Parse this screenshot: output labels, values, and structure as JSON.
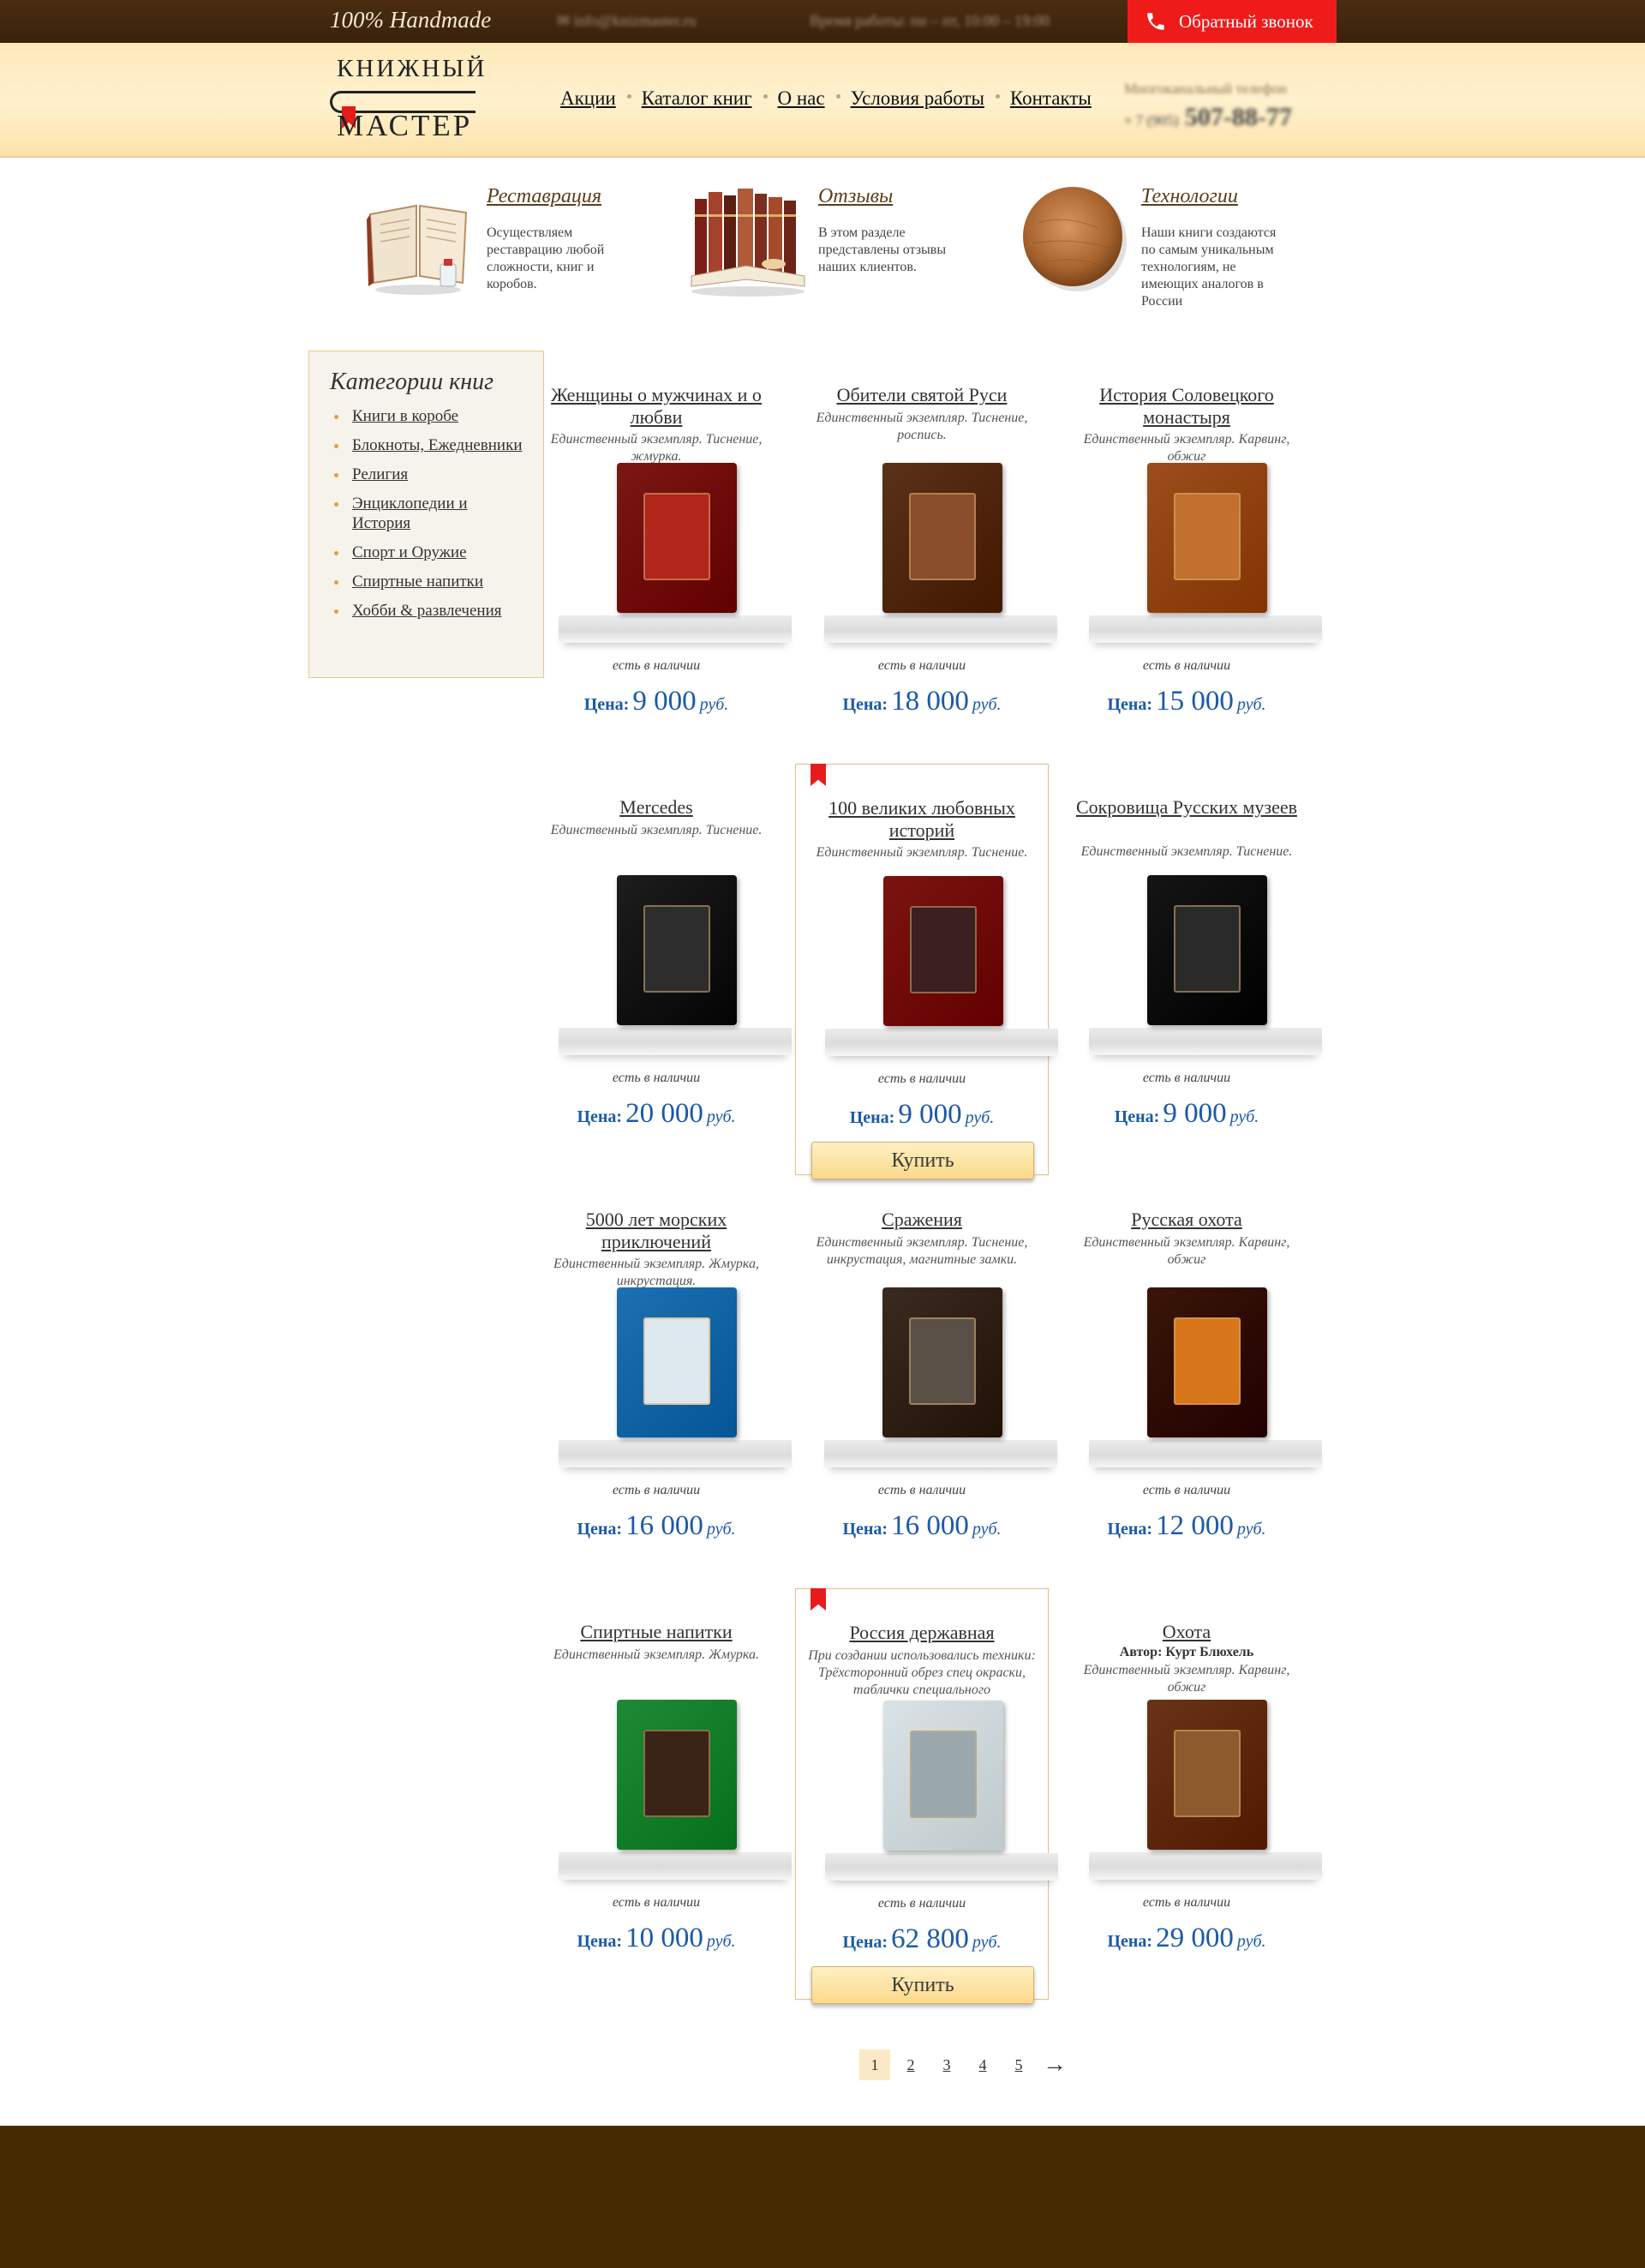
{
  "topbar": {
    "tagline": "100% Handmade",
    "email": "✉ info@knizmaster.ru",
    "hours": "Время работы: пн – пт, 10:00 – 19:00",
    "callback_label": "Обратный звонок"
  },
  "header": {
    "logo_line1": "КНИЖНЫЙ",
    "logo_line2": "МАСТЕР",
    "nav": [
      "Акции",
      "Каталог книг",
      "О нас",
      "Условия работы",
      "Контакты"
    ],
    "phone_label": "Многоканальный телефон",
    "phone_prefix": "+ 7 (905)",
    "phone_number": "507-88-77"
  },
  "features": [
    {
      "title": "Реставрация",
      "text": "Осуществляем реставрацию любой сложности, книг и коробов.",
      "icon": "open-book-icon"
    },
    {
      "title": "Отзывы",
      "text": "В этом разделе представлены отзывы наших клиентов.",
      "icon": "book-stack-icon"
    },
    {
      "title": "Технологии",
      "text": "Наши книги создаются по самым уникальным технологиям, не имеющих аналогов в России",
      "icon": "leather-icon"
    }
  ],
  "sidebar": {
    "title": "Категории книг",
    "items": [
      "Книги в коробе",
      "Блокноты, Ежедневники",
      "Религия",
      "Энциклопедии и История",
      "Спорт и Оружие",
      "Спиртные напитки",
      "Хобби & развлечения"
    ]
  },
  "catalog": {
    "price_label": "Цена:",
    "currency": "руб.",
    "stock_label": "есть в наличии",
    "buy_label": "Купить"
  },
  "products": [
    {
      "title": "Женщины о мужчинах и о любви",
      "desc": "Единственный экземпляр. Тиснение, жмурка.",
      "price": "9 000",
      "cover": "#7a1814",
      "inset": "#b2251d"
    },
    {
      "title": "Обители святой Руси",
      "desc": "Единственный экземпляр. Тиснение, роспись.",
      "price": "18 000",
      "cover": "#5a3119",
      "inset": "#8a4e2c"
    },
    {
      "title": "История Соловецкого монастыря",
      "desc": "Единственный экземпляр. Карвинг, обжиг",
      "price": "15 000",
      "cover": "#9b4e1b",
      "inset": "#c2702d"
    },
    {
      "title": "Mercedes",
      "desc": "Единственный экземпляр. Тиснение.",
      "price": "20 000",
      "cover": "#1d1d1d",
      "inset": "#2d2d2d"
    },
    {
      "title": "100 великих любовных историй",
      "desc": "Единственный экземпляр. Тиснение.",
      "price": "9 000",
      "cover": "#7b1410",
      "inset": "#3a2020"
    },
    {
      "title": "Сокровища Русских музеев",
      "desc": "Единственный экземпляр. Тиснение.",
      "price": "9 000",
      "cover": "#151515",
      "inset": "#2a2a2a"
    },
    {
      "title": "5000 лет морских приключений",
      "desc": "Единственный экземпляр. Жмурка, инкрустация.",
      "price": "16 000",
      "cover": "#1d6fb0",
      "inset": "#dde8ef"
    },
    {
      "title": "Сражения",
      "desc": "Единственный экземпляр. Тиснение, инкрустация, магнитные замки.",
      "price": "16 000",
      "cover": "#3b2a1f",
      "inset": "#5b5048"
    },
    {
      "title": "Русская охота",
      "desc": "Единственный экземпляр. Карвинг, обжиг",
      "price": "12 000",
      "cover": "#3a1608",
      "inset": "#d7751b"
    },
    {
      "title": "Спиртные напитки",
      "desc": "Единственный экземпляр. Жмурка.",
      "price": "10 000",
      "cover": "#1e8a36",
      "inset": "#3a2418"
    },
    {
      "title": "Россия державная",
      "desc": "При создании использовались техники: Трёхсторонний обрез спец окраски, таблички специального",
      "price": "62 800",
      "cover": "#d9e3e6",
      "inset": "#9aa8ad"
    },
    {
      "title": "Охота",
      "author": "Автор: Курт Блюхель",
      "desc": "Единственный экземпляр. Карвинг, обжиг",
      "price": "29 000",
      "cover": "#6a3318",
      "inset": "#8c5a2c"
    }
  ],
  "pagination": {
    "pages": [
      "1",
      "2",
      "3",
      "4",
      "5"
    ],
    "current": "1",
    "next": "→"
  }
}
